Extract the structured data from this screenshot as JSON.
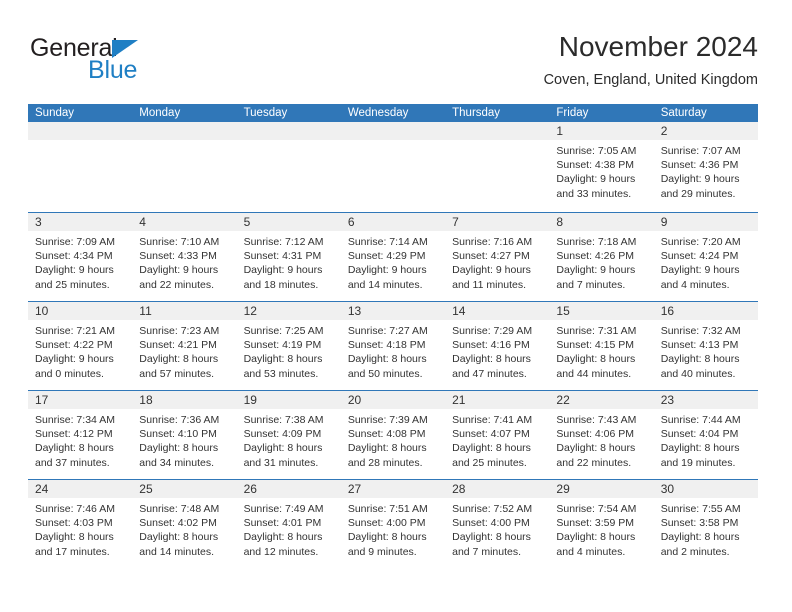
{
  "brand": {
    "name_part1": "General",
    "name_part2": "Blue"
  },
  "header": {
    "title": "November 2024",
    "location": "Coven, England, United Kingdom"
  },
  "colors": {
    "header_blue": "#3077b8",
    "day_band_gray": "#f0f0f0",
    "logo_blue": "#1f7fc4",
    "text": "#333333"
  },
  "weekdays": [
    "Sunday",
    "Monday",
    "Tuesday",
    "Wednesday",
    "Thursday",
    "Friday",
    "Saturday"
  ],
  "weeks": [
    [
      {
        "day": "",
        "sunrise": "",
        "sunset": "",
        "daylight_line1": "",
        "daylight_line2": ""
      },
      {
        "day": "",
        "sunrise": "",
        "sunset": "",
        "daylight_line1": "",
        "daylight_line2": ""
      },
      {
        "day": "",
        "sunrise": "",
        "sunset": "",
        "daylight_line1": "",
        "daylight_line2": ""
      },
      {
        "day": "",
        "sunrise": "",
        "sunset": "",
        "daylight_line1": "",
        "daylight_line2": ""
      },
      {
        "day": "",
        "sunrise": "",
        "sunset": "",
        "daylight_line1": "",
        "daylight_line2": ""
      },
      {
        "day": "1",
        "sunrise": "Sunrise: 7:05 AM",
        "sunset": "Sunset: 4:38 PM",
        "daylight_line1": "Daylight: 9 hours",
        "daylight_line2": "and 33 minutes."
      },
      {
        "day": "2",
        "sunrise": "Sunrise: 7:07 AM",
        "sunset": "Sunset: 4:36 PM",
        "daylight_line1": "Daylight: 9 hours",
        "daylight_line2": "and 29 minutes."
      }
    ],
    [
      {
        "day": "3",
        "sunrise": "Sunrise: 7:09 AM",
        "sunset": "Sunset: 4:34 PM",
        "daylight_line1": "Daylight: 9 hours",
        "daylight_line2": "and 25 minutes."
      },
      {
        "day": "4",
        "sunrise": "Sunrise: 7:10 AM",
        "sunset": "Sunset: 4:33 PM",
        "daylight_line1": "Daylight: 9 hours",
        "daylight_line2": "and 22 minutes."
      },
      {
        "day": "5",
        "sunrise": "Sunrise: 7:12 AM",
        "sunset": "Sunset: 4:31 PM",
        "daylight_line1": "Daylight: 9 hours",
        "daylight_line2": "and 18 minutes."
      },
      {
        "day": "6",
        "sunrise": "Sunrise: 7:14 AM",
        "sunset": "Sunset: 4:29 PM",
        "daylight_line1": "Daylight: 9 hours",
        "daylight_line2": "and 14 minutes."
      },
      {
        "day": "7",
        "sunrise": "Sunrise: 7:16 AM",
        "sunset": "Sunset: 4:27 PM",
        "daylight_line1": "Daylight: 9 hours",
        "daylight_line2": "and 11 minutes."
      },
      {
        "day": "8",
        "sunrise": "Sunrise: 7:18 AM",
        "sunset": "Sunset: 4:26 PM",
        "daylight_line1": "Daylight: 9 hours",
        "daylight_line2": "and 7 minutes."
      },
      {
        "day": "9",
        "sunrise": "Sunrise: 7:20 AM",
        "sunset": "Sunset: 4:24 PM",
        "daylight_line1": "Daylight: 9 hours",
        "daylight_line2": "and 4 minutes."
      }
    ],
    [
      {
        "day": "10",
        "sunrise": "Sunrise: 7:21 AM",
        "sunset": "Sunset: 4:22 PM",
        "daylight_line1": "Daylight: 9 hours",
        "daylight_line2": "and 0 minutes."
      },
      {
        "day": "11",
        "sunrise": "Sunrise: 7:23 AM",
        "sunset": "Sunset: 4:21 PM",
        "daylight_line1": "Daylight: 8 hours",
        "daylight_line2": "and 57 minutes."
      },
      {
        "day": "12",
        "sunrise": "Sunrise: 7:25 AM",
        "sunset": "Sunset: 4:19 PM",
        "daylight_line1": "Daylight: 8 hours",
        "daylight_line2": "and 53 minutes."
      },
      {
        "day": "13",
        "sunrise": "Sunrise: 7:27 AM",
        "sunset": "Sunset: 4:18 PM",
        "daylight_line1": "Daylight: 8 hours",
        "daylight_line2": "and 50 minutes."
      },
      {
        "day": "14",
        "sunrise": "Sunrise: 7:29 AM",
        "sunset": "Sunset: 4:16 PM",
        "daylight_line1": "Daylight: 8 hours",
        "daylight_line2": "and 47 minutes."
      },
      {
        "day": "15",
        "sunrise": "Sunrise: 7:31 AM",
        "sunset": "Sunset: 4:15 PM",
        "daylight_line1": "Daylight: 8 hours",
        "daylight_line2": "and 44 minutes."
      },
      {
        "day": "16",
        "sunrise": "Sunrise: 7:32 AM",
        "sunset": "Sunset: 4:13 PM",
        "daylight_line1": "Daylight: 8 hours",
        "daylight_line2": "and 40 minutes."
      }
    ],
    [
      {
        "day": "17",
        "sunrise": "Sunrise: 7:34 AM",
        "sunset": "Sunset: 4:12 PM",
        "daylight_line1": "Daylight: 8 hours",
        "daylight_line2": "and 37 minutes."
      },
      {
        "day": "18",
        "sunrise": "Sunrise: 7:36 AM",
        "sunset": "Sunset: 4:10 PM",
        "daylight_line1": "Daylight: 8 hours",
        "daylight_line2": "and 34 minutes."
      },
      {
        "day": "19",
        "sunrise": "Sunrise: 7:38 AM",
        "sunset": "Sunset: 4:09 PM",
        "daylight_line1": "Daylight: 8 hours",
        "daylight_line2": "and 31 minutes."
      },
      {
        "day": "20",
        "sunrise": "Sunrise: 7:39 AM",
        "sunset": "Sunset: 4:08 PM",
        "daylight_line1": "Daylight: 8 hours",
        "daylight_line2": "and 28 minutes."
      },
      {
        "day": "21",
        "sunrise": "Sunrise: 7:41 AM",
        "sunset": "Sunset: 4:07 PM",
        "daylight_line1": "Daylight: 8 hours",
        "daylight_line2": "and 25 minutes."
      },
      {
        "day": "22",
        "sunrise": "Sunrise: 7:43 AM",
        "sunset": "Sunset: 4:06 PM",
        "daylight_line1": "Daylight: 8 hours",
        "daylight_line2": "and 22 minutes."
      },
      {
        "day": "23",
        "sunrise": "Sunrise: 7:44 AM",
        "sunset": "Sunset: 4:04 PM",
        "daylight_line1": "Daylight: 8 hours",
        "daylight_line2": "and 19 minutes."
      }
    ],
    [
      {
        "day": "24",
        "sunrise": "Sunrise: 7:46 AM",
        "sunset": "Sunset: 4:03 PM",
        "daylight_line1": "Daylight: 8 hours",
        "daylight_line2": "and 17 minutes."
      },
      {
        "day": "25",
        "sunrise": "Sunrise: 7:48 AM",
        "sunset": "Sunset: 4:02 PM",
        "daylight_line1": "Daylight: 8 hours",
        "daylight_line2": "and 14 minutes."
      },
      {
        "day": "26",
        "sunrise": "Sunrise: 7:49 AM",
        "sunset": "Sunset: 4:01 PM",
        "daylight_line1": "Daylight: 8 hours",
        "daylight_line2": "and 12 minutes."
      },
      {
        "day": "27",
        "sunrise": "Sunrise: 7:51 AM",
        "sunset": "Sunset: 4:00 PM",
        "daylight_line1": "Daylight: 8 hours",
        "daylight_line2": "and 9 minutes."
      },
      {
        "day": "28",
        "sunrise": "Sunrise: 7:52 AM",
        "sunset": "Sunset: 4:00 PM",
        "daylight_line1": "Daylight: 8 hours",
        "daylight_line2": "and 7 minutes."
      },
      {
        "day": "29",
        "sunrise": "Sunrise: 7:54 AM",
        "sunset": "Sunset: 3:59 PM",
        "daylight_line1": "Daylight: 8 hours",
        "daylight_line2": "and 4 minutes."
      },
      {
        "day": "30",
        "sunrise": "Sunrise: 7:55 AM",
        "sunset": "Sunset: 3:58 PM",
        "daylight_line1": "Daylight: 8 hours",
        "daylight_line2": "and 2 minutes."
      }
    ]
  ]
}
